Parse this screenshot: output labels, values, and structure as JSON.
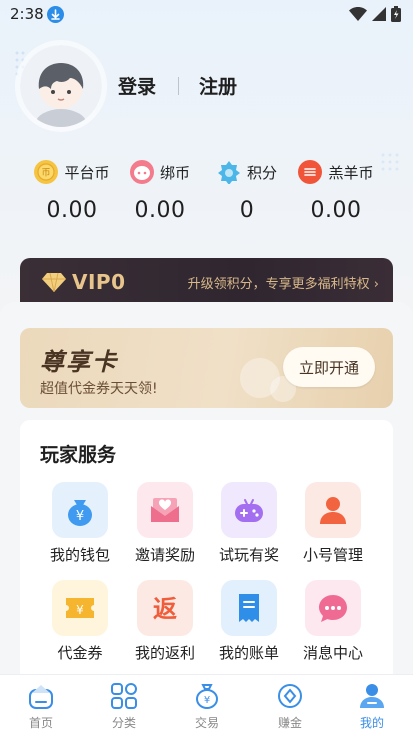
{
  "status_bar": {
    "time": "2:38"
  },
  "auth": {
    "login": "登录",
    "register": "注册"
  },
  "currencies": [
    {
      "icon": "platform-coin-icon",
      "label": "平台币",
      "value": "0.00"
    },
    {
      "icon": "bound-coin-icon",
      "label": "绑币",
      "value": "0.00"
    },
    {
      "icon": "points-icon",
      "label": "积分",
      "value": "0"
    },
    {
      "icon": "lamb-coin-icon",
      "label": "羔羊币",
      "value": "0.00"
    }
  ],
  "vip": {
    "title": "VIP0",
    "promo": "升级领积分，专享更多福利特权"
  },
  "premium_card": {
    "title": "尊享卡",
    "subtitle": "超值代金券天天领!",
    "button": "立即开通"
  },
  "services": {
    "title": "玩家服务",
    "items": [
      {
        "icon": "wallet-icon",
        "label": "我的钱包"
      },
      {
        "icon": "invite-icon",
        "label": "邀请奖励"
      },
      {
        "icon": "gamepad-icon",
        "label": "试玩有奖"
      },
      {
        "icon": "account-icon",
        "label": "小号管理"
      },
      {
        "icon": "voucher-icon",
        "label": "代金券"
      },
      {
        "icon": "rebate-icon",
        "label": "我的返利"
      },
      {
        "icon": "bill-icon",
        "label": "我的账单"
      },
      {
        "icon": "message-icon",
        "label": "消息中心"
      }
    ]
  },
  "tabbar": {
    "items": [
      {
        "icon": "home-icon",
        "label": "首页"
      },
      {
        "icon": "category-icon",
        "label": "分类"
      },
      {
        "icon": "trade-icon",
        "label": "交易"
      },
      {
        "icon": "earn-icon",
        "label": "赚金"
      },
      {
        "icon": "profile-icon",
        "label": "我的"
      }
    ],
    "active": "我的"
  },
  "colors": {
    "accent": "#3a8ee6",
    "vip_gold": "#e8c58c",
    "vip_bg": "#2f2630"
  }
}
